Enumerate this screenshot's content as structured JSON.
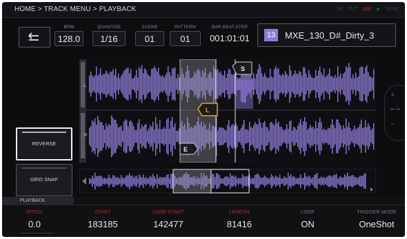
{
  "header": {
    "breadcrumb": "HOME > TRACK MENU > PLAYBACK",
    "status": [
      "IN",
      "OUT",
      "REC",
      "SYNC"
    ]
  },
  "params": {
    "bpm": {
      "label": "BPM",
      "value": "128.0"
    },
    "quantize": {
      "label": "QUANTIZE",
      "value": "1/16"
    },
    "scene": {
      "label": "SCENE",
      "value": "01"
    },
    "pattern": {
      "label": "PATTERN",
      "value": "01"
    },
    "bar_beat_step": {
      "label": "BAR.BEAT.STEP",
      "value": "001:01:01"
    }
  },
  "sample": {
    "number": "13",
    "name": "MXE_130_D#_Dirty_3"
  },
  "waveform": {
    "channel_left": "L",
    "channel_right": "R",
    "marker_start": "S",
    "marker_loop": "L",
    "marker_end": "E"
  },
  "side_buttons": {
    "reverse": "REVERSE",
    "grid_snap": "GRID SNAP"
  },
  "zoom": {
    "in": "+",
    "out": "−"
  },
  "bottom": {
    "tab": "PLAYBACK",
    "pitch": {
      "label": "PITCH",
      "value": "0.0"
    },
    "start": {
      "label": "START",
      "value": "183185"
    },
    "loop_start": {
      "label": "LOOP START",
      "value": "142477"
    },
    "length": {
      "label": "LENGTH",
      "value": "81416"
    },
    "loop": {
      "label": "LOOP",
      "value": "ON"
    },
    "trigger_mode": {
      "label": "TRIGGER MODE",
      "value": "OneShot"
    }
  },
  "colors": {
    "accent": "#8e7bd6",
    "marker": "#f0a020",
    "label_red": "#b5303a"
  }
}
